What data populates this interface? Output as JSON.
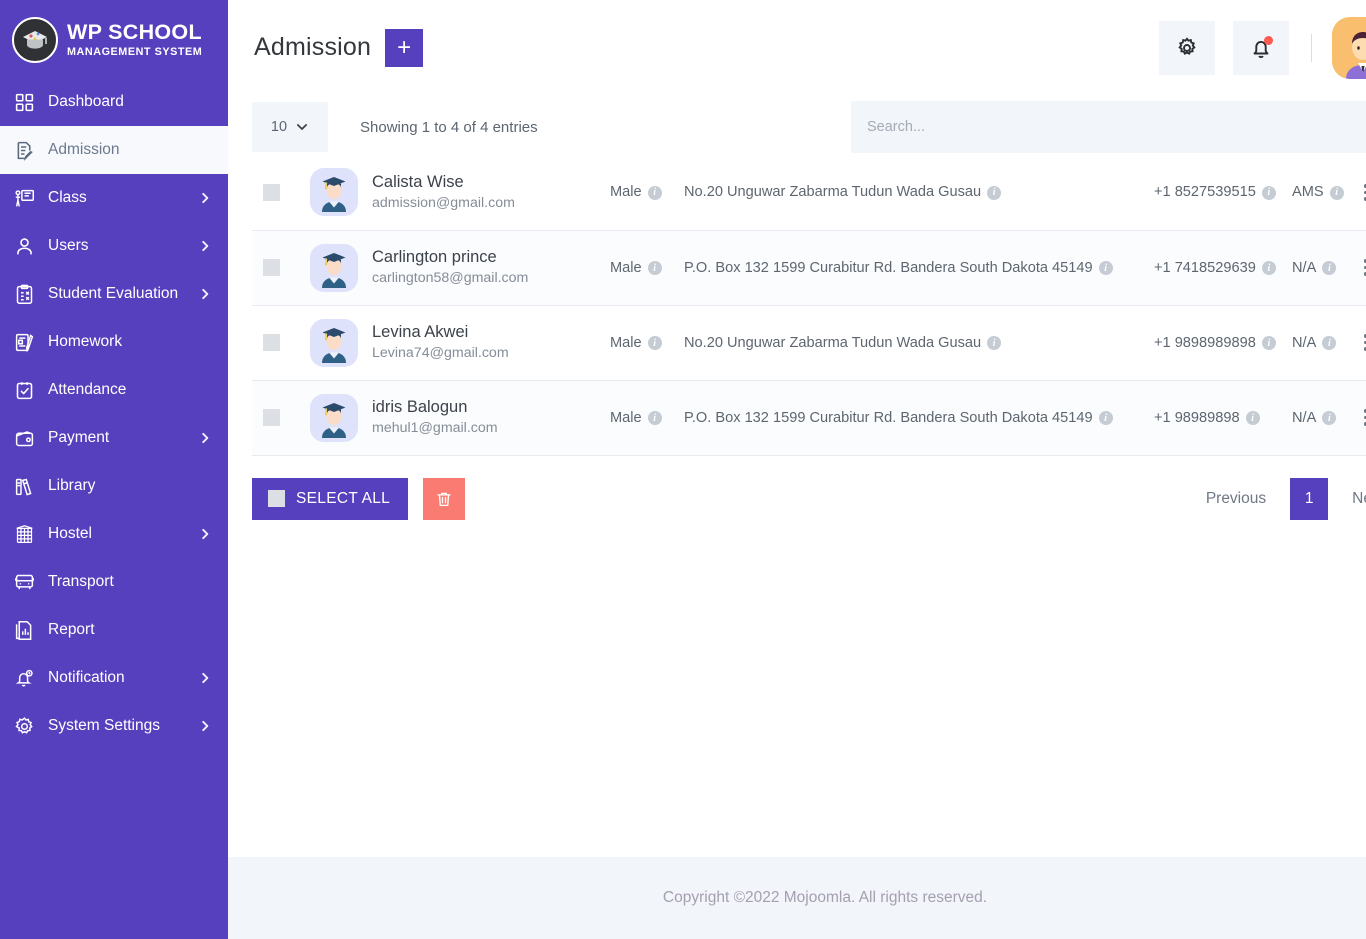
{
  "brand": {
    "title": "WP SCHOOL",
    "subtitle": "MANAGEMENT SYSTEM",
    "logo_icon": "graduation-cap-logo-icon"
  },
  "sidebar": {
    "items": [
      {
        "label": "Dashboard",
        "icon": "grid-icon",
        "has_arrow": false,
        "active": false
      },
      {
        "label": "Admission",
        "icon": "document-edit-icon",
        "has_arrow": false,
        "active": true
      },
      {
        "label": "Class",
        "icon": "classroom-icon",
        "has_arrow": true,
        "active": false
      },
      {
        "label": "Users",
        "icon": "user-icon",
        "has_arrow": true,
        "active": false
      },
      {
        "label": "Student Evaluation",
        "icon": "clipboard-x-icon",
        "has_arrow": true,
        "active": false
      },
      {
        "label": "Homework",
        "icon": "book-pencil-icon",
        "has_arrow": false,
        "active": false
      },
      {
        "label": "Attendance",
        "icon": "clipboard-check-icon",
        "has_arrow": false,
        "active": false
      },
      {
        "label": "Payment",
        "icon": "wallet-icon",
        "has_arrow": true,
        "active": false
      },
      {
        "label": "Library",
        "icon": "books-icon",
        "has_arrow": false,
        "active": false
      },
      {
        "label": "Hostel",
        "icon": "building-icon",
        "has_arrow": true,
        "active": false
      },
      {
        "label": "Transport",
        "icon": "bus-icon",
        "has_arrow": false,
        "active": false
      },
      {
        "label": "Report",
        "icon": "report-icon",
        "has_arrow": false,
        "active": false
      },
      {
        "label": "Notification",
        "icon": "bell-clock-icon",
        "has_arrow": true,
        "active": false
      },
      {
        "label": "System Settings",
        "icon": "gear-icon",
        "has_arrow": true,
        "active": false
      }
    ]
  },
  "header": {
    "title": "Admission",
    "add_button_label": "+",
    "settings_icon": "gear-icon",
    "notification_icon": "bell-icon",
    "notification_badge": true,
    "avatar_icon": "user-avatar-icon"
  },
  "table_controls": {
    "page_length": "10",
    "entries_info": "Showing 1 to 4 of 4 entries",
    "search_placeholder": "Search...",
    "search_value": ""
  },
  "table": {
    "rows": [
      {
        "name": "Calista Wise",
        "email": "admission@gmail.com",
        "gender": "Male",
        "address": "No.20 Unguwar Zabarma Tudun Wada Gusau",
        "phone": "+1 8527539515",
        "ams": "AMS"
      },
      {
        "name": "Carlington prince",
        "email": "carlington58@gmail.com",
        "gender": "Male",
        "address": "P.O. Box 132 1599 Curabitur Rd. Bandera South Dakota 45149",
        "phone": "+1 7418529639",
        "ams": "N/A"
      },
      {
        "name": "Levina Akwei",
        "email": "Levina74@gmail.com",
        "gender": "Male",
        "address": "No.20 Unguwar Zabarma Tudun Wada Gusau",
        "phone": "+1 9898989898",
        "ams": "N/A"
      },
      {
        "name": "idris Balogun",
        "email": "mehul1@gmail.com",
        "gender": "Male",
        "address": "P.O. Box 132 1599 Curabitur Rd. Bandera South Dakota 45149",
        "phone": "+1 98989898",
        "ams": "N/A"
      }
    ]
  },
  "bottom": {
    "select_all_label": "SELECT ALL",
    "delete_icon": "trash-icon",
    "previous_label": "Previous",
    "current_page": "1",
    "next_label": "Next"
  },
  "footer": {
    "text": "Copyright ©2022 Mojoomla. All rights reserved."
  },
  "colors": {
    "brand_purple": "#5740bd",
    "danger_red": "#fa7b72",
    "panel_grey": "#f2f5fa",
    "text_grey": "#5d6670",
    "avatar_orange": "#f9bf6f"
  }
}
